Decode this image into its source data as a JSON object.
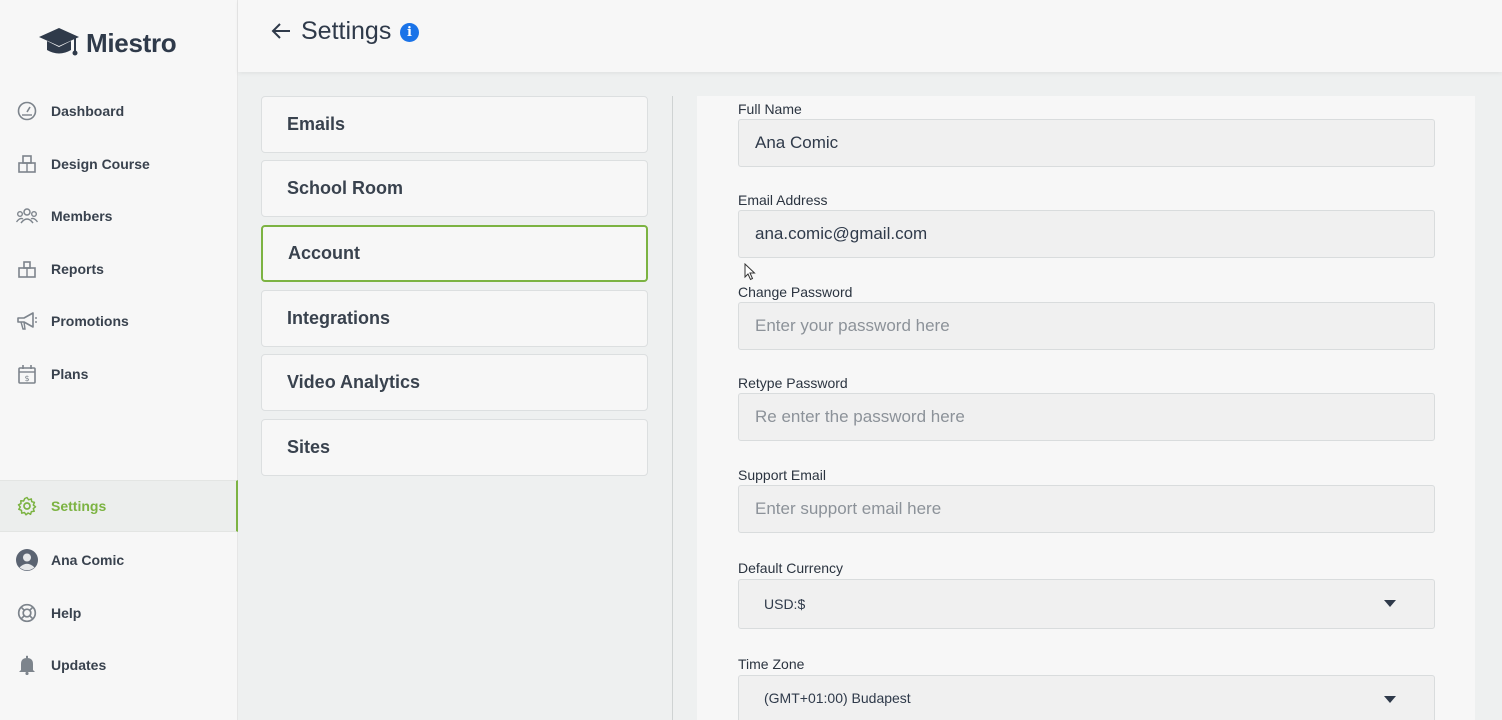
{
  "app": {
    "name": "Miestro"
  },
  "sidebar": {
    "items": [
      {
        "label": "Dashboard",
        "icon": "dashboard-icon"
      },
      {
        "label": "Design Course",
        "icon": "design-course-icon"
      },
      {
        "label": "Members",
        "icon": "members-icon"
      },
      {
        "label": "Reports",
        "icon": "reports-icon"
      },
      {
        "label": "Promotions",
        "icon": "megaphone-icon"
      },
      {
        "label": "Plans",
        "icon": "plans-icon"
      }
    ],
    "bottom_items": [
      {
        "label": "Settings",
        "icon": "gear-icon",
        "active": true
      },
      {
        "label": "Ana Comic",
        "icon": "avatar-icon"
      },
      {
        "label": "Help",
        "icon": "lifebuoy-icon"
      },
      {
        "label": "Updates",
        "icon": "bell-icon"
      }
    ],
    "accent_color": "#7cb342"
  },
  "header": {
    "title": "Settings",
    "info_icon": "i"
  },
  "settings_tabs": [
    {
      "label": "Emails"
    },
    {
      "label": "School Room"
    },
    {
      "label": "Account",
      "active": true
    },
    {
      "label": "Integrations"
    },
    {
      "label": "Video Analytics"
    },
    {
      "label": "Sites"
    }
  ],
  "form": {
    "full_name": {
      "label": "Full Name",
      "value": "Ana Comic"
    },
    "email": {
      "label": "Email Address",
      "value": "ana.comic@gmail.com"
    },
    "change_password": {
      "label": "Change Password",
      "placeholder": "Enter your password here"
    },
    "retype_password": {
      "label": "Retype Password",
      "placeholder": "Re enter the password here"
    },
    "support_email": {
      "label": "Support Email",
      "placeholder": "Enter support email here"
    },
    "default_currency": {
      "label": "Default Currency",
      "value": "USD:$"
    },
    "time_zone": {
      "label": "Time Zone",
      "value": "(GMT+01:00) Budapest"
    }
  }
}
